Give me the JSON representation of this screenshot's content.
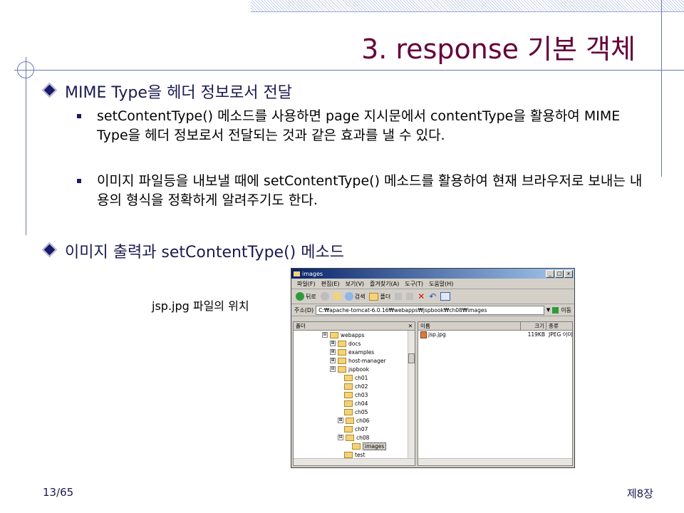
{
  "title": "3. response 기본 객체",
  "bullets": [
    {
      "text": "MIME Type을 헤더 정보로서 전달"
    },
    {
      "text": "이미지 출력과 setContentType() 메소드"
    }
  ],
  "subbullets": [
    "setContentType() 메소드를 사용하면 page 지시문에서 contentType을 활용하여 MIME Type을 헤더 정보로서 전달되는 것과 같은 효과를 낼 수 있다.",
    "이미지 파일등을 내보낼 때에 setContentType() 메소드를 활용하여 현재 브라우저로 보내는 내용의 형식을 정확하게 알려주기도 한다."
  ],
  "caption": "jsp.jpg 파일의 위치",
  "footer": {
    "page": "13/65",
    "chapter": "제8장"
  },
  "explorer": {
    "window_title": "images",
    "title_buttons": [
      "_",
      "□",
      "x"
    ],
    "menu": [
      "파일(F)",
      "편집(E)",
      "보기(V)",
      "즐겨찾기(A)",
      "도구(T)",
      "도움말(H)"
    ],
    "toolbar": {
      "back": "뒤로",
      "search": "검색",
      "folders": "폴더"
    },
    "address_label": "주소(D)",
    "address": "C:₩apache-tomcat-6.0.16₩webapps₩jspbook₩ch08₩images",
    "go": "이동",
    "folder_pane_title": "폴더",
    "tree": [
      {
        "label": "webapps",
        "level": 0,
        "pm": "⊟"
      },
      {
        "label": "docs",
        "level": 1,
        "pm": "⊞"
      },
      {
        "label": "examples",
        "level": 1,
        "pm": "⊞"
      },
      {
        "label": "host-manager",
        "level": 1,
        "pm": "⊞"
      },
      {
        "label": "jspbook",
        "level": 1,
        "pm": "⊟"
      },
      {
        "label": "ch01",
        "level": 2,
        "pm": ""
      },
      {
        "label": "ch02",
        "level": 2,
        "pm": ""
      },
      {
        "label": "ch03",
        "level": 2,
        "pm": ""
      },
      {
        "label": "ch04",
        "level": 2,
        "pm": ""
      },
      {
        "label": "ch05",
        "level": 2,
        "pm": ""
      },
      {
        "label": "ch06",
        "level": 2,
        "pm": "⊞"
      },
      {
        "label": "ch07",
        "level": 2,
        "pm": ""
      },
      {
        "label": "ch08",
        "level": 2,
        "pm": "⊟"
      },
      {
        "label": "images",
        "level": 3,
        "pm": "",
        "selected": true
      },
      {
        "label": "test",
        "level": 2,
        "pm": ""
      }
    ],
    "columns": [
      "이름",
      "크기",
      "종류"
    ],
    "files": [
      {
        "name": "jsp.jpg",
        "size": "119KB",
        "type": "JPEG 이미지"
      }
    ]
  }
}
